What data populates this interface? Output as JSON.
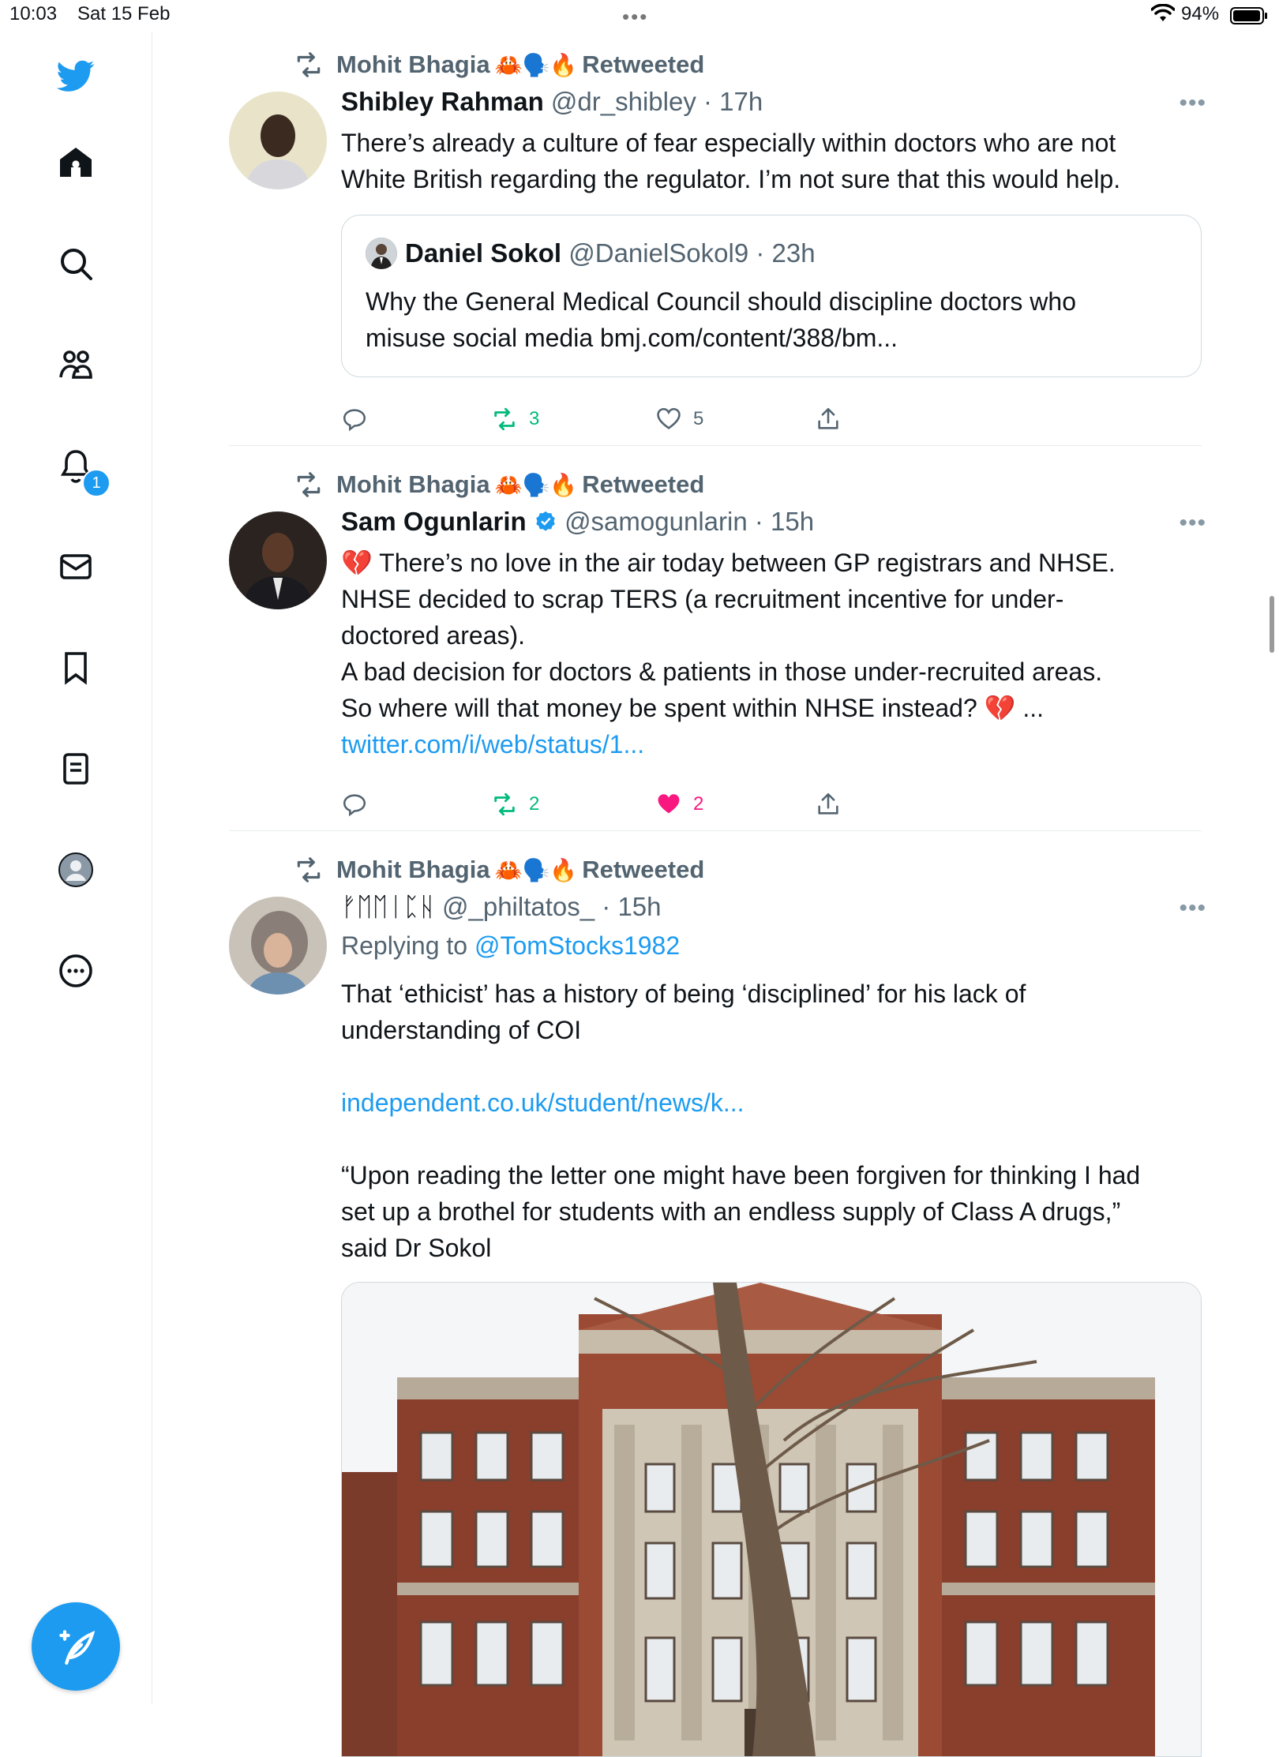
{
  "status_bar": {
    "time": "10:03",
    "date": "Sat 15 Feb",
    "battery": "94%"
  },
  "sidebar": {
    "items": [
      {
        "icon": "twitter-bird-icon"
      },
      {
        "icon": "home-icon"
      },
      {
        "icon": "search-icon"
      },
      {
        "icon": "communities-icon"
      },
      {
        "icon": "notifications-icon",
        "badge": "1"
      },
      {
        "icon": "messages-icon"
      },
      {
        "icon": "bookmarks-icon"
      },
      {
        "icon": "lists-icon"
      },
      {
        "icon": "profile-icon"
      },
      {
        "icon": "more-icon"
      }
    ],
    "compose_icon": "compose-tweet-icon"
  },
  "tweets": [
    {
      "retweeted_by": "Mohit Bhagia",
      "retweeted_label": "Retweeted",
      "emojis": "🦀🗣️🔥",
      "name": "Shibley Rahman",
      "handle": "@dr_shibley",
      "time": "· 17h",
      "text_lines": [
        "There’s already a culture of fear especially  within doctors who are not",
        "White British regarding the regulator.  I’m not sure that this would help."
      ],
      "quote": {
        "name": "Daniel Sokol",
        "handle": "@DanielSokol9",
        "time": "· 23h",
        "text_lines": [
          "Why the General Medical Council should discipline doctors who",
          "misuse social media bmj.com/content/388/bm..."
        ]
      },
      "retweets": "3",
      "likes": "5"
    },
    {
      "retweeted_by": "Mohit Bhagia",
      "retweeted_label": "Retweeted",
      "emojis": "🦀🗣️🔥",
      "name": "Sam Ogunlarin",
      "handle": "@samogunlarin",
      "time": "· 15h",
      "text_lines": [
        "💔 There’s no love in the air today between GP registrars and NHSE.",
        "NHSE decided to scrap TERS (a recruitment incentive for under-",
        "doctored areas).",
        "A bad decision for doctors & patients in those under-recruited areas.",
        "So where will that money be spent within NHSE instead? 💔 ..."
      ],
      "link": "twitter.com/i/web/status/1...",
      "retweets": "2",
      "likes": "2"
    },
    {
      "retweeted_by": "Mohit Bhagia",
      "retweeted_label": "Retweeted",
      "emojis": "🦀🗣️🔥",
      "name": "ᚠᛖᛖᛁᛈᚺ",
      "handle": "@_philtatos_",
      "time": "· 15h",
      "replying_to_label": "Replying to",
      "replying_to": "@TomStocks1982",
      "text_lines": [
        "That ‘ethicist’ has a history of being  ‘disciplined’ for his lack of",
        "understanding of COI"
      ],
      "link": "independent.co.uk/student/news/k...",
      "quote_lines": [
        "“Upon reading the letter one might have been forgiven for thinking I had",
        "set up a brothel for students with an endless supply of Class A drugs,”",
        "said Dr Sokol"
      ]
    }
  ],
  "colors": {
    "accent": "#1d9bf0",
    "retweet": "#00ba7c",
    "like": "#f91880",
    "muted": "#536471"
  }
}
